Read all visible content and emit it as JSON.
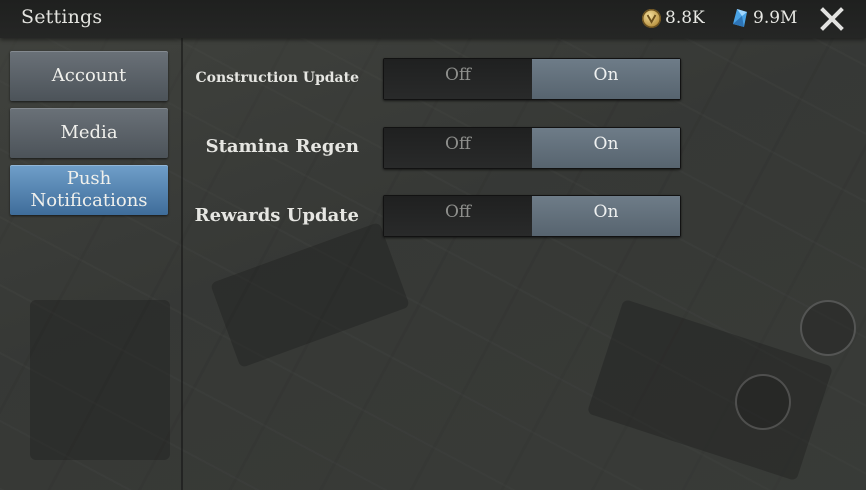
{
  "header": {
    "title": "Settings",
    "coins": "8.8K",
    "gems": "9.9M"
  },
  "sidebar": {
    "items": [
      {
        "label": "Account",
        "active": false
      },
      {
        "label": "Media",
        "active": false
      },
      {
        "label": "Push Notifications",
        "active": true
      }
    ]
  },
  "settings": [
    {
      "label": "Construction Update",
      "off_label": "Off",
      "on_label": "On",
      "selected": "On"
    },
    {
      "label": "Stamina Regen",
      "off_label": "Off",
      "on_label": "On",
      "selected": "On"
    },
    {
      "label": "Rewards Update",
      "off_label": "Off",
      "on_label": "On",
      "selected": "On"
    }
  ],
  "colors": {
    "active_tab": "#4f7fae",
    "toggle_on": "#607080",
    "toggle_off": "#242525"
  }
}
